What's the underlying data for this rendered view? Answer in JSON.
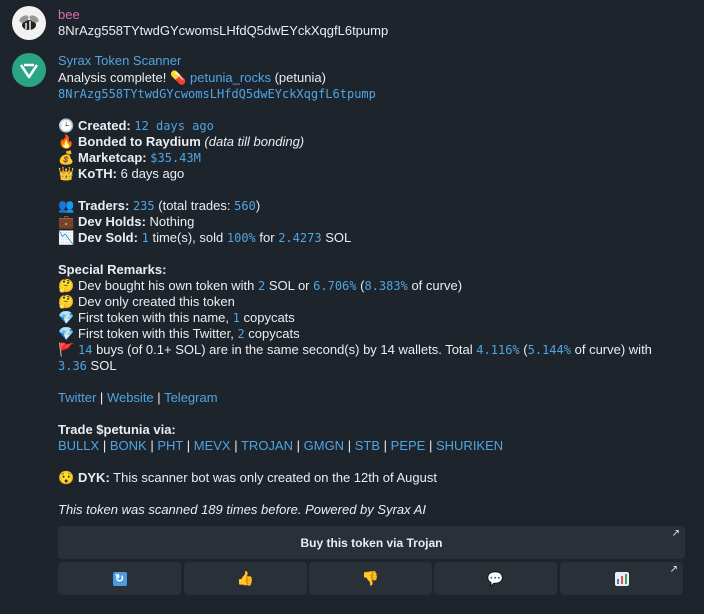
{
  "msg1": {
    "sender": "bee",
    "text": "8NrAzg558TYtwdGYcwomsLHfdQ5dwEYckXqgfL6tpump"
  },
  "msg2": {
    "sender": "Syrax Token Scanner",
    "analysis_prefix": "Analysis complete!",
    "token_link": "petunia_rocks",
    "token_name": "(petunia)",
    "address": "8NrAzg558TYtwdGYcwomsLHfdQ5dwEYckXqgfL6tpump",
    "created_label": "Created:",
    "created_value": "12 days ago",
    "bonded_label": "Bonded to Raydium",
    "bonded_note": "(data till bonding)",
    "marketcap_label": "Marketcap:",
    "marketcap_value": "$35.43M",
    "koth_label": "KoTH:",
    "koth_value": "6 days ago",
    "traders_label": "Traders:",
    "traders_value": "235",
    "traders_mid": "(total trades:",
    "trades_value": "560",
    "traders_end": ")",
    "devholds_label": "Dev Holds:",
    "devholds_value": "Nothing",
    "devsold_label": "Dev Sold:",
    "devsold_times": "1",
    "devsold_mid": "time(s), sold",
    "devsold_pct": "100%",
    "devsold_for": "for",
    "devsold_sol": "2.4273",
    "devsold_unit": "SOL",
    "remarks_title": "Special Remarks:",
    "r1_a": "Dev bought his own token with",
    "r1_sol": "2",
    "r1_b": "SOL or",
    "r1_pct": "6.706%",
    "r1_c": "(",
    "r1_curve": "8.383%",
    "r1_d": "of curve)",
    "r2": "Dev only created this token",
    "r3_a": "First token with this name,",
    "r3_n": "1",
    "r3_b": "copycats",
    "r4_a": "First token with this Twitter,",
    "r4_n": "2",
    "r4_b": "copycats",
    "r5_n": "14",
    "r5_a": "buys (of 0.1+ SOL) are in the same second(s) by 14 wallets. Total",
    "r5_pct": "4.116%",
    "r5_b": "(",
    "r5_curve": "5.144%",
    "r5_c": "of curve) with",
    "r5_sol": "3.36",
    "r5_d": "SOL",
    "links": [
      "Twitter",
      "Website",
      "Telegram"
    ],
    "trade_title": "Trade $petunia via:",
    "trade_links": [
      "BULLX",
      "BONK",
      "PHT",
      "MEVX",
      "TROJAN",
      "GMGN",
      "STB",
      "PEPE",
      "SHURIKEN"
    ],
    "dyk_label": "DYK:",
    "dyk_text": "This scanner bot was only created on the 12th of August",
    "footer": "This token was scanned 189 times before. Powered by Syrax AI"
  },
  "buttons": {
    "main": "Buy this token via Trojan",
    "row": [
      "refresh-icon",
      "thumbs-up-icon",
      "thumbs-down-icon",
      "speech-bubble-icon",
      "bar-chart-icon"
    ]
  }
}
